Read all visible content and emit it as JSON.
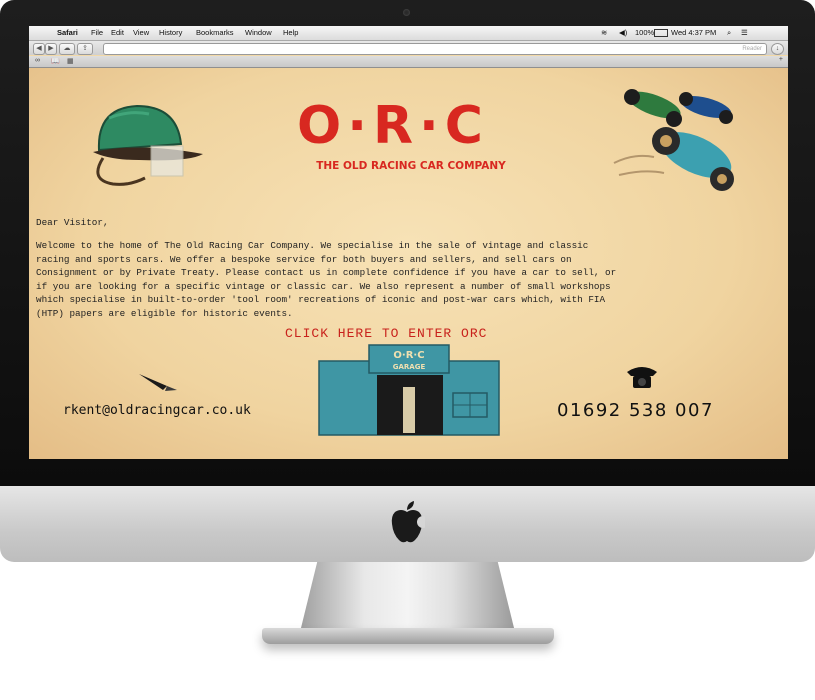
{
  "menubar": {
    "app": "Safari",
    "items": [
      "File",
      "Edit",
      "View",
      "History",
      "Bookmarks",
      "Window",
      "Help"
    ],
    "battery": "100%",
    "clock": "Wed 4:37 PM"
  },
  "toolbar": {
    "reader_label": "Reader",
    "url": ""
  },
  "site": {
    "logo": "O·R·C",
    "tagline": "THE OLD RACING CAR COMPANY",
    "greeting": "Dear Visitor,",
    "body_lines": [
      "Welcome to the home of The Old Racing Car Company. We specialise in the sale of vintage and classic",
      "racing and sports cars. We offer a bespoke service for both buyers and sellers, and sell cars on",
      "Consignment or by Private Treaty. Please contact us in complete confidence if you have a car to sell, or",
      "if you are looking for a specific vintage or classic car. We also represent a number of small workshops",
      "which specialise in built-to-order 'tool room' recreations of iconic and post-war cars which, with FIA",
      "(HTP) papers are eligible for historic events."
    ],
    "enter_link": "CLICK HERE TO ENTER ORC",
    "garage_sign_top": "O·R·C",
    "garage_sign_bottom": "GARAGE",
    "email": "rkent@oldracingcar.co.uk",
    "phone": "01692 538 007"
  },
  "colors": {
    "brand_red": "#d82820",
    "page_bg": "#f2d9a8",
    "garage_blue": "#3f96a4"
  }
}
